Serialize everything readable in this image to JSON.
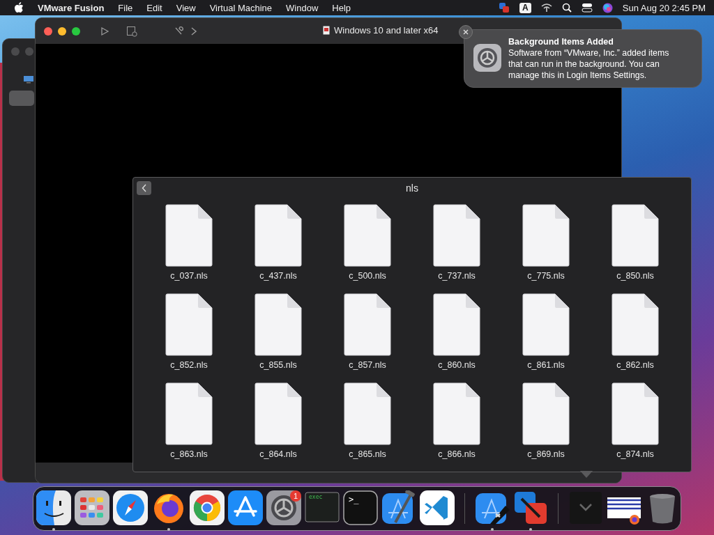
{
  "menu_bar": {
    "app_name": "VMware Fusion",
    "menus": [
      "File",
      "Edit",
      "View",
      "Virtual Machine",
      "Window",
      "Help"
    ],
    "input_source": "A",
    "clock": "Sun Aug 20  2:45 PM"
  },
  "vm_window": {
    "title": "Windows 10 and later x64"
  },
  "notification": {
    "title": "Background Items Added",
    "body": "Software from “VMware, Inc.” added items that can run in the background. You can manage this in Login Items Settings."
  },
  "stack": {
    "title": "nls",
    "files": [
      "c_037.nls",
      "c_437.nls",
      "c_500.nls",
      "c_737.nls",
      "c_775.nls",
      "c_850.nls",
      "c_852.nls",
      "c_855.nls",
      "c_857.nls",
      "c_860.nls",
      "c_861.nls",
      "c_862.nls",
      "c_863.nls",
      "c_864.nls",
      "c_865.nls",
      "c_866.nls",
      "c_869.nls",
      "c_874.nls"
    ]
  },
  "dock": {
    "items": [
      {
        "kind": "finder",
        "running": true
      },
      {
        "kind": "launchpad",
        "running": false
      },
      {
        "kind": "safari",
        "running": false
      },
      {
        "kind": "firefox",
        "running": true
      },
      {
        "kind": "chrome",
        "running": false
      },
      {
        "kind": "appstore",
        "running": false
      },
      {
        "kind": "settings",
        "running": false,
        "badge": "1"
      },
      {
        "kind": "console",
        "running": false,
        "label": "exec"
      },
      {
        "kind": "terminal",
        "running": false,
        "label": ">_"
      },
      {
        "kind": "xcode",
        "running": false
      },
      {
        "kind": "vscode",
        "running": false
      },
      {
        "kind": "separator"
      },
      {
        "kind": "xcodetool",
        "running": true
      },
      {
        "kind": "vmware",
        "running": true
      },
      {
        "kind": "separator"
      },
      {
        "kind": "downloads",
        "running": false
      },
      {
        "kind": "document",
        "running": false
      },
      {
        "kind": "trash",
        "running": false
      }
    ]
  }
}
